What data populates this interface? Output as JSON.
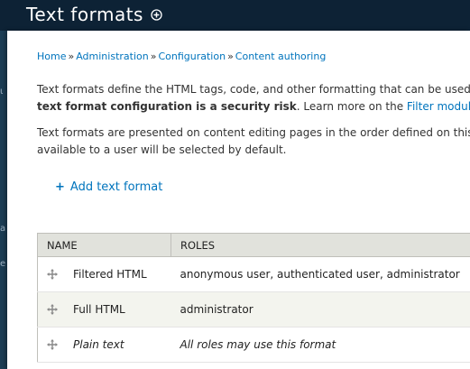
{
  "header": {
    "title": "Text formats",
    "shortcut_icon": "add-shortcut-icon"
  },
  "breadcrumb": [
    {
      "label": "Home"
    },
    {
      "label": "Administration"
    },
    {
      "label": "Configuration"
    },
    {
      "label": "Content authoring"
    }
  ],
  "breadcrumb_separator": "»",
  "description": {
    "para1_line1": "Text formats define the HTML tags, code, and other formatting that can be used",
    "para1_line2_bold": "text format configuration is a security risk",
    "para1_line2_rest": ". Learn more on the ",
    "para1_line2_link": "Filter module he",
    "para2_line1": "Text formats are presented on content editing pages in the order defined on this",
    "para2_line2": "available to a user will be selected by default."
  },
  "add_link": {
    "icon": "+",
    "label": "Add text format"
  },
  "table": {
    "headers": [
      "NAME",
      "ROLES"
    ],
    "rows": [
      {
        "name": "Filtered HTML",
        "roles": "anonymous user, authenticated user, administrator",
        "italic": false
      },
      {
        "name": "Full HTML",
        "roles": "administrator",
        "italic": false
      },
      {
        "name": "Plain text",
        "roles": "All roles may use this format",
        "italic": true
      }
    ]
  },
  "left_fragments": [
    "ι",
    "a",
    "e"
  ],
  "colors": {
    "header_bg": "#0d2235",
    "link": "#0074bd",
    "table_header_bg": "#e1e2dc",
    "row_even_bg": "#f3f4ee"
  }
}
